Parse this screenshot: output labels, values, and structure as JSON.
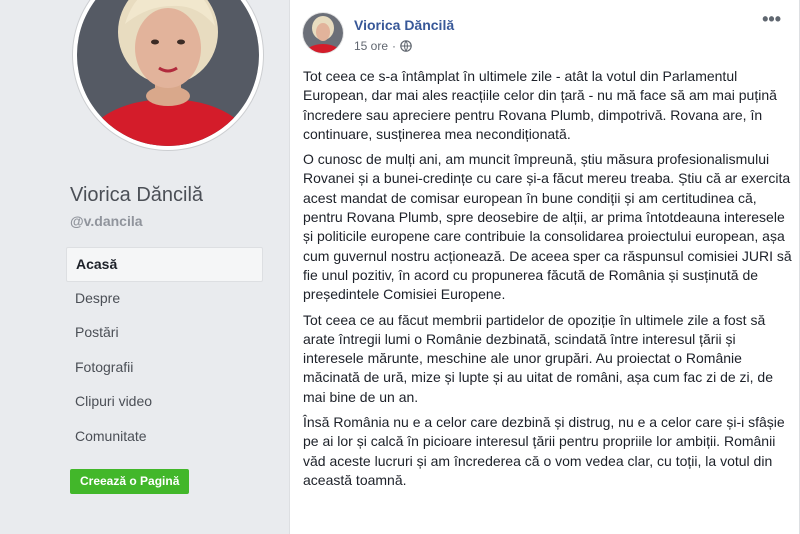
{
  "profile": {
    "name": "Viorica Dăncilă",
    "handle": "@v.dancila"
  },
  "nav": {
    "items": [
      {
        "label": "Acasă"
      },
      {
        "label": "Despre"
      },
      {
        "label": "Postări"
      },
      {
        "label": "Fotografii"
      },
      {
        "label": "Clipuri video"
      },
      {
        "label": "Comunitate"
      }
    ],
    "create_page_label": "Creează o Pagină"
  },
  "post": {
    "author": "Viorica Dăncilă",
    "time": "15 ore",
    "separator": "·",
    "audience_icon": "globe-icon",
    "more_icon": "•••",
    "paragraphs": [
      "Tot ceea ce s-a întâmplat în ultimele zile - atât la votul din Parlamentul European, dar mai ales reacțiile celor din țară - nu mă face să am mai puțină încredere sau apreciere pentru Rovana Plumb, dimpotrivă. Rovana are, în continuare, susținerea mea necondiționată.",
      "O cunosc de mulți ani, am muncit împreună, știu măsura profesionalismului Rovanei și a bunei-credințe cu care și-a făcut mereu treaba. Știu că ar exercita acest mandat de comisar european în bune condiții și am certitudinea că, pentru Rovana Plumb, spre deosebire de alții, ar prima întotdeauna interesele și politicile europene care contribuie la consolidarea proiectului european, așa cum guvernul nostru acționează. De aceea sper ca răspunsul comisiei JURI să fie unul pozitiv, în acord cu propunerea făcută de România și susținută de președintele Comisiei Europene.",
      "Tot ceea ce au făcut membrii partidelor de opoziție în ultimele zile a fost să arate întregii lumi o Românie dezbinată, scindată între interesul țării și interesele mărunte, meschine ale unor grupări. Au proiectat o Românie măcinată de ură, mize și lupte și au uitat de români, așa cum fac zi de zi, de mai bine de un an.",
      "Însă România nu e a celor care dezbină și distrug, nu e a celor care și-i sfâșie pe ai lor și calcă în picioare interesul țării pentru propriile lor ambiții. Românii văd aceste lucruri și am încrederea că o vom vedea clar, cu toții, la votul din această toamnă."
    ]
  },
  "colors": {
    "link": "#385898",
    "create_button": "#42b72a",
    "background": "#e9ebee"
  }
}
